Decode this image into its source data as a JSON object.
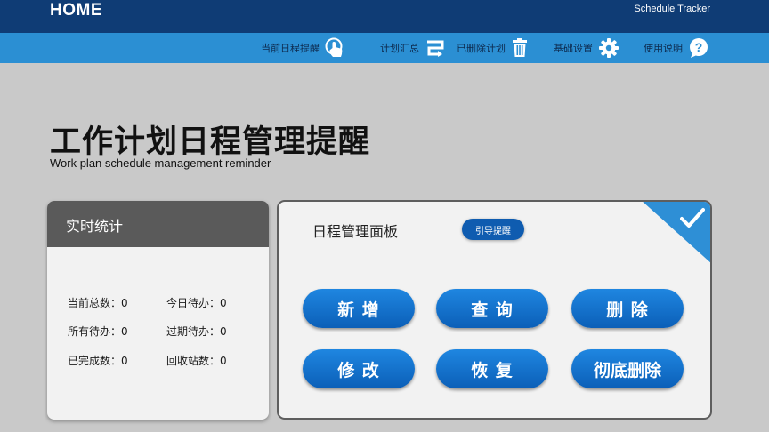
{
  "header": {
    "home_label": "HOME",
    "brand": "Schedule Tracker"
  },
  "nav": {
    "reminder": {
      "label": "当前日程提醒",
      "icon": "touch-hand-icon"
    },
    "summary": {
      "label": "计划汇总",
      "icon": "summary-arrow-icon"
    },
    "deleted": {
      "label": "已删除计划",
      "icon": "trash-icon"
    },
    "settings": {
      "label": "基础设置",
      "icon": "gear-icon"
    },
    "help": {
      "label": "使用说明",
      "icon": "help-bubble-icon"
    }
  },
  "page": {
    "title": "工作计划日程管理提醒",
    "subtitle": "Work plan schedule management reminder"
  },
  "stats": {
    "header": "实时统计",
    "items": [
      {
        "label": "当前总数：0"
      },
      {
        "label": "今日待办：0"
      },
      {
        "label": "所有待办：0"
      },
      {
        "label": "过期待办：0"
      },
      {
        "label": "已完成数：0"
      },
      {
        "label": "回收站数：0"
      }
    ]
  },
  "panel": {
    "title": "日程管理面板",
    "guide_label": "引导提醒",
    "buttons": {
      "add": "新  增",
      "query": "查  询",
      "delete": "删  除",
      "edit": "修  改",
      "restore": "恢  复",
      "purge": "彻底删除"
    }
  },
  "colors": {
    "topbar": "#0f3c75",
    "navbar": "#2b8fd3",
    "background": "#c9c9c9",
    "button_blue": "#1675cf"
  }
}
